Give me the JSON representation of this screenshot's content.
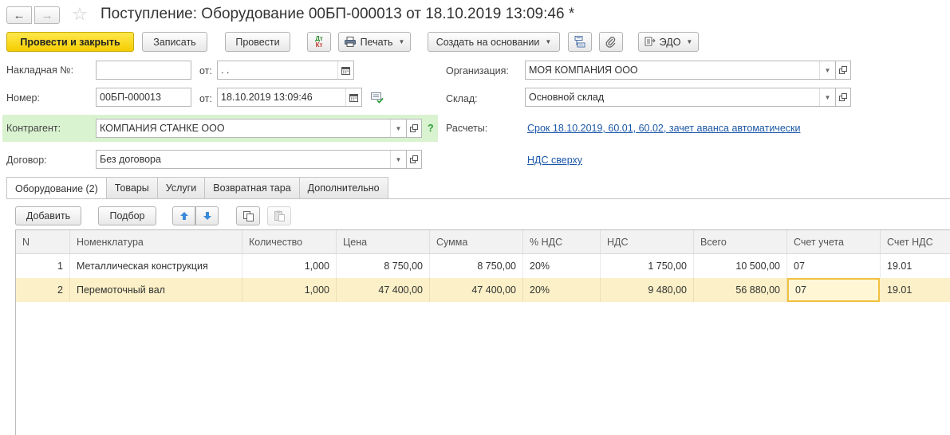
{
  "window": {
    "title": "Поступление: Оборудование 00БП-000013 от 18.10.2019 13:09:46 *"
  },
  "nav": {
    "back_icon": "←",
    "forward_icon": "→",
    "star_icon": "☆"
  },
  "toolbar": {
    "post_close": "Провести и закрыть",
    "save": "Записать",
    "post": "Провести",
    "dtkt_top": "Дт",
    "dtkt_bottom": "Кт",
    "print": "Печать",
    "create_based": "Создать на основании",
    "edo": "ЭДО"
  },
  "form": {
    "invoice_label": "Накладная  №:",
    "invoice_number": "",
    "from_label": "от:",
    "invoice_date": " .  .",
    "number_label": "Номер:",
    "number_value": "00БП-000013",
    "from_label2": "от:",
    "date_value": "18.10.2019 13:09:46",
    "contractor_label": "Контрагент:",
    "contractor_value": "КОМПАНИЯ СТАНКЕ ООО",
    "help_mark": "?",
    "contract_label": "Договор:",
    "contract_value": "Без договора",
    "org_label": "Организация:",
    "org_value": "МОЯ КОМПАНИЯ ООО",
    "warehouse_label": "Склад:",
    "warehouse_value": "Основной склад",
    "settlements_label": "Расчеты:",
    "settlements_link": "Срок 18.10.2019, 60.01, 60.02, зачет аванса автоматически",
    "vat_link": "НДС сверху"
  },
  "tabs": [
    {
      "label": "Оборудование (2)",
      "active": true
    },
    {
      "label": "Товары",
      "active": false
    },
    {
      "label": "Услуги",
      "active": false
    },
    {
      "label": "Возвратная тара",
      "active": false
    },
    {
      "label": "Дополнительно",
      "active": false
    }
  ],
  "table_toolbar": {
    "add": "Добавить",
    "pick": "Подбор"
  },
  "table": {
    "columns": [
      "N",
      "Номенклатура",
      "Количество",
      "Цена",
      "Сумма",
      "% НДС",
      "НДС",
      "Всего",
      "Счет учета",
      "Счет НДС"
    ],
    "rows": [
      {
        "n": "1",
        "item": "Металлическая конструкция",
        "qty": "1,000",
        "price": "8 750,00",
        "sum": "8 750,00",
        "vat_rate": "20%",
        "vat": "1 750,00",
        "total": "10 500,00",
        "account": "07",
        "vat_account": "19.01"
      },
      {
        "n": "2",
        "item": "Перемоточный вал",
        "qty": "1,000",
        "price": "47 400,00",
        "sum": "47 400,00",
        "vat_rate": "20%",
        "vat": "9 480,00",
        "total": "56 880,00",
        "account": "07",
        "vat_account": "19.01"
      }
    ]
  },
  "colors": {
    "primary_button": "#f5cd00",
    "contractor_highlight": "#d9f2cf",
    "selected_row": "#fbf0c7",
    "link": "#1b57a8"
  }
}
